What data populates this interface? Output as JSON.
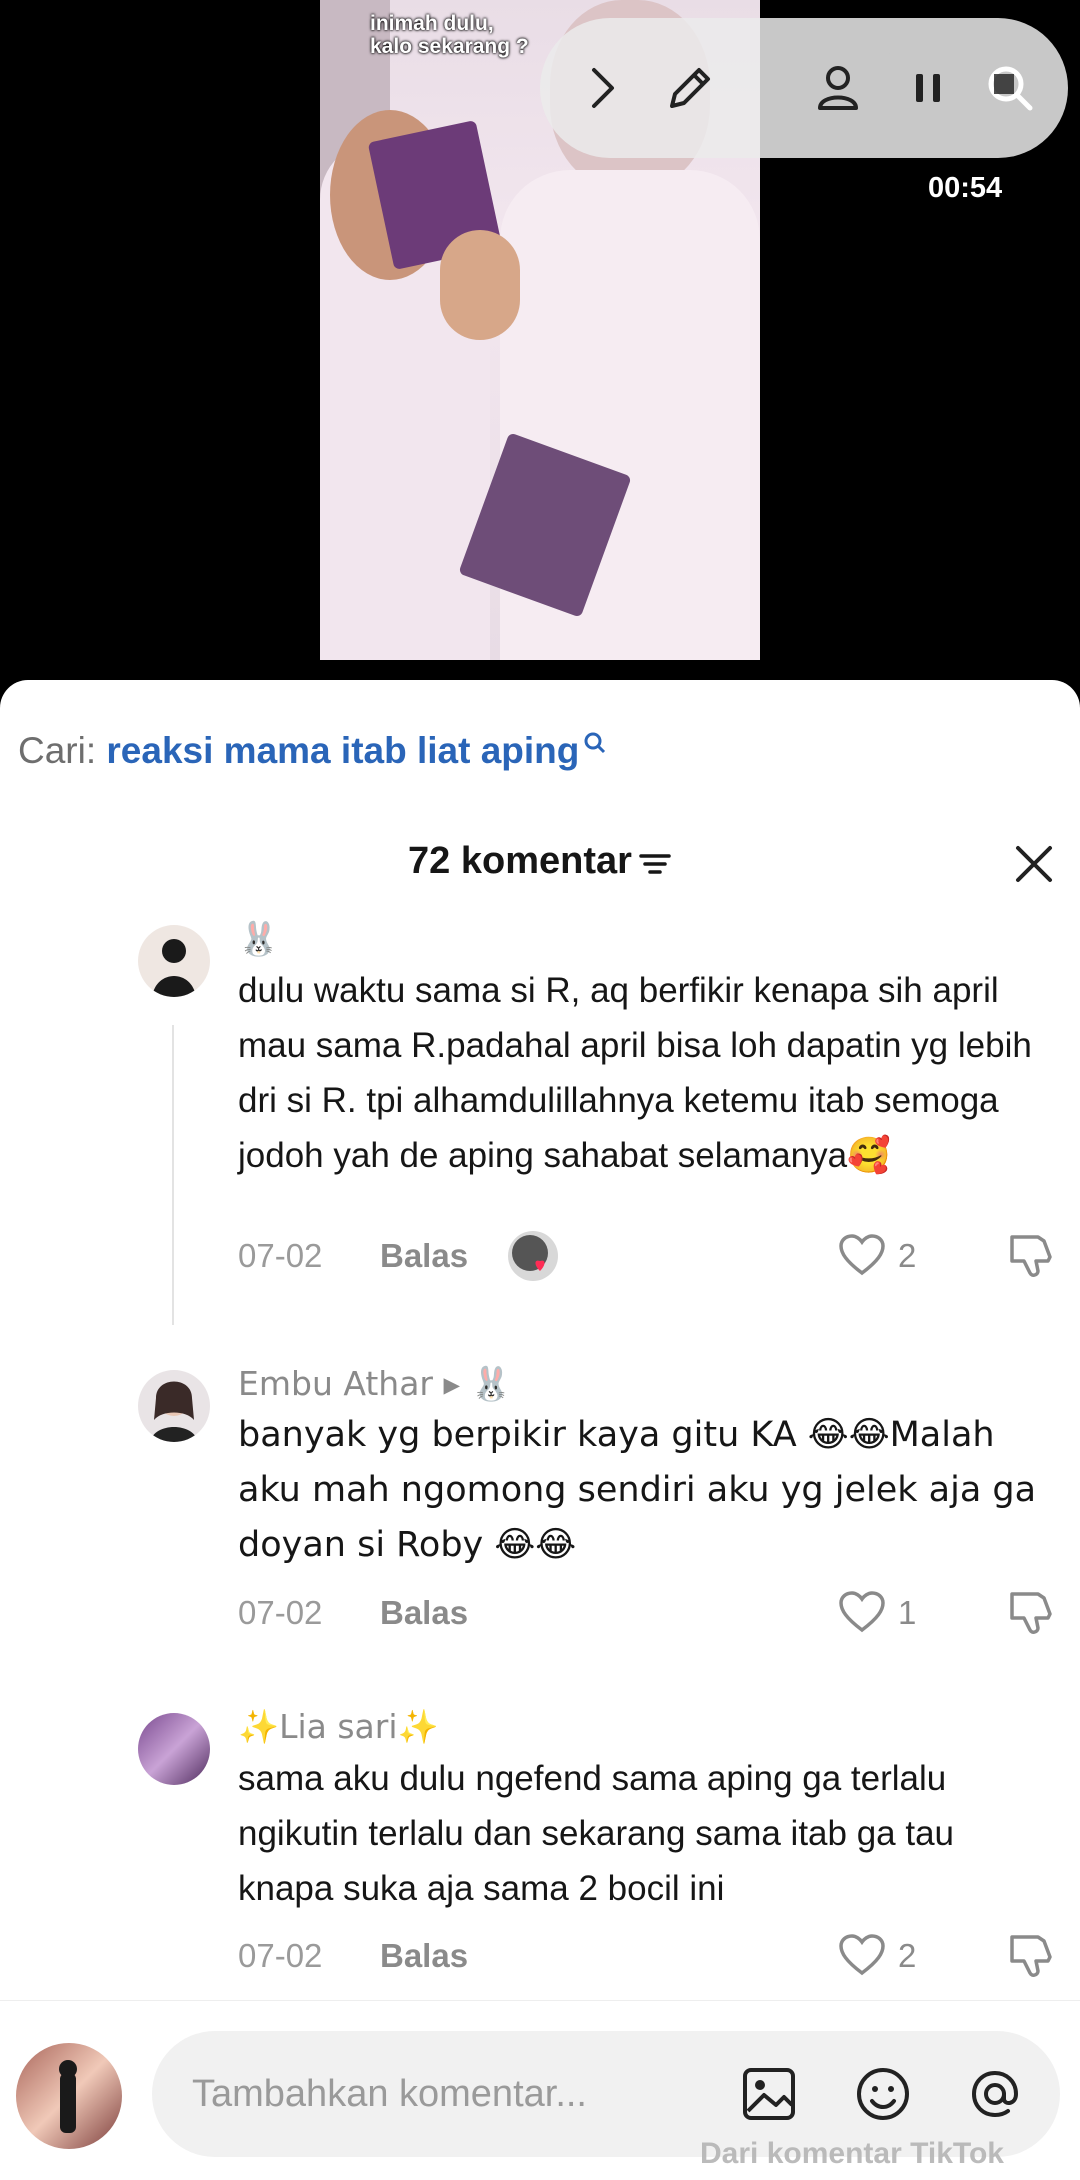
{
  "video": {
    "caption": "inimah dulu,\nkalo sekarang ?",
    "timer": "00:54"
  },
  "controls": {
    "icons": [
      "chevron-right-icon",
      "pencil-icon",
      "person-icon",
      "pause-icon",
      "search-icon"
    ]
  },
  "search": {
    "prefix": "Cari:",
    "term": "reaksi mama itab liat aping"
  },
  "comments_header": {
    "count_label": "72 komentar"
  },
  "comments": [
    {
      "username": "🐰",
      "text": "dulu waktu sama si R, aq berfikir kenapa sih april mau sama R.padahal april bisa loh dapatin yg lebih dri si R. tpi alhamdulillahnya ketemu itab semoga jodoh yah de aping sahabat selamanya🥰",
      "date": "07-02",
      "reply_label": "Balas",
      "likes": "2"
    },
    {
      "username": "Embu Athar ▸ 🐰",
      "text": "banyak yg berpikir kaya gitu KA 😂😂Malah aku mah ngomong sendiri aku yg jelek aja ga doyan si Roby 😂😂",
      "date": "07-02",
      "reply_label": "Balas",
      "likes": "1"
    },
    {
      "username": "✨Lia sari✨",
      "text": "sama aku dulu ngefend sama aping ga terlalu ngikutin terlalu dan sekarang sama itab ga tau knapa suka aja sama 2 bocil ini",
      "date": "07-02",
      "reply_label": "Balas",
      "likes": "2"
    }
  ],
  "input": {
    "placeholder": "Tambahkan komentar...",
    "watermark": "Dari komentar TikTok"
  }
}
